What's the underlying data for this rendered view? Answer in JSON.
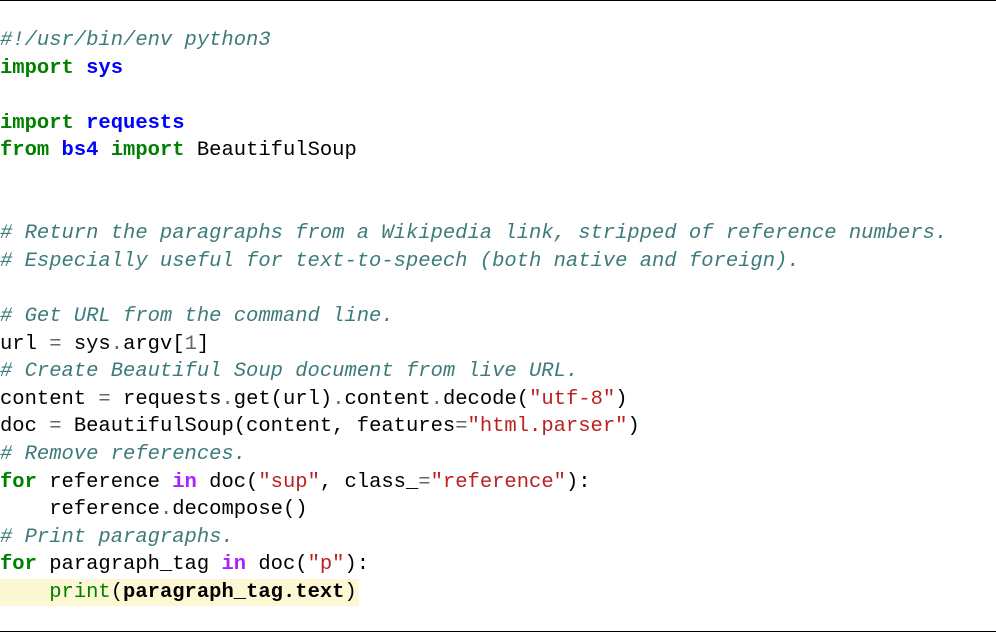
{
  "colors": {
    "background": "#ffffff",
    "highlight": "#fdf8d4",
    "comment": "#3d7b7b",
    "keyword": "#008000",
    "namespace": "#0000ff",
    "operator": "#666666",
    "string": "#ba2121",
    "operator_word": "#aa22ff",
    "builtin": "#008000"
  },
  "code": {
    "language": "python",
    "highlighted_lines": [
      20,
      21
    ],
    "lines": [
      [
        {
          "t": "#!/usr/bin/env python3",
          "k": "comment"
        }
      ],
      [
        {
          "t": "import",
          "k": "keyword"
        },
        {
          "t": " "
        },
        {
          "t": "sys",
          "k": "namespace"
        }
      ],
      [],
      [
        {
          "t": "import",
          "k": "keyword"
        },
        {
          "t": " "
        },
        {
          "t": "requests",
          "k": "namespace"
        }
      ],
      [
        {
          "t": "from",
          "k": "keyword"
        },
        {
          "t": " "
        },
        {
          "t": "bs4",
          "k": "namespace"
        },
        {
          "t": " "
        },
        {
          "t": "import",
          "k": "keyword"
        },
        {
          "t": " BeautifulSoup"
        }
      ],
      [],
      [],
      [
        {
          "t": "# Return the paragraphs from a Wikipedia link, stripped of reference numbers.",
          "k": "comment"
        }
      ],
      [
        {
          "t": "# Especially useful for text-to-speech (both native and foreign).",
          "k": "comment"
        }
      ],
      [],
      [
        {
          "t": "# Get URL from the command line.",
          "k": "comment"
        }
      ],
      [
        {
          "t": "url "
        },
        {
          "t": "=",
          "k": "operator"
        },
        {
          "t": " sys"
        },
        {
          "t": ".",
          "k": "operator"
        },
        {
          "t": "argv["
        },
        {
          "t": "1",
          "k": "number"
        },
        {
          "t": "]"
        }
      ],
      [
        {
          "t": "# Create Beautiful Soup document from live URL.",
          "k": "comment"
        }
      ],
      [
        {
          "t": "content "
        },
        {
          "t": "=",
          "k": "operator"
        },
        {
          "t": " requests"
        },
        {
          "t": ".",
          "k": "operator"
        },
        {
          "t": "get(url)"
        },
        {
          "t": ".",
          "k": "operator"
        },
        {
          "t": "content"
        },
        {
          "t": ".",
          "k": "operator"
        },
        {
          "t": "decode("
        },
        {
          "t": "\"utf-8\"",
          "k": "string"
        },
        {
          "t": ")"
        }
      ],
      [
        {
          "t": "doc "
        },
        {
          "t": "=",
          "k": "operator"
        },
        {
          "t": " BeautifulSoup(content, features"
        },
        {
          "t": "=",
          "k": "operator"
        },
        {
          "t": "\"html.parser\"",
          "k": "string"
        },
        {
          "t": ")"
        }
      ],
      [
        {
          "t": "# Remove references.",
          "k": "comment"
        }
      ],
      [
        {
          "t": "for",
          "k": "keyword"
        },
        {
          "t": " reference "
        },
        {
          "t": "in",
          "k": "opword"
        },
        {
          "t": " doc("
        },
        {
          "t": "\"sup\"",
          "k": "string"
        },
        {
          "t": ", class_"
        },
        {
          "t": "=",
          "k": "operator"
        },
        {
          "t": "\"reference\"",
          "k": "string"
        },
        {
          "t": "):"
        }
      ],
      [
        {
          "t": "    reference"
        },
        {
          "t": ".",
          "k": "operator"
        },
        {
          "t": "decompose()"
        }
      ],
      [
        {
          "t": "# Print paragraphs.",
          "k": "comment"
        }
      ],
      [
        {
          "t": "for",
          "k": "keyword"
        },
        {
          "t": " paragraph_tag "
        },
        {
          "t": "in",
          "k": "opword"
        },
        {
          "t": " doc("
        },
        {
          "t": "\"p\"",
          "k": "string"
        },
        {
          "t": "):"
        }
      ],
      [
        {
          "t": "    "
        },
        {
          "t": "print",
          "k": "builtin"
        },
        {
          "t": "("
        },
        {
          "t": "paragraph_tag.text",
          "k": "bold"
        },
        {
          "t": ")"
        }
      ]
    ]
  }
}
